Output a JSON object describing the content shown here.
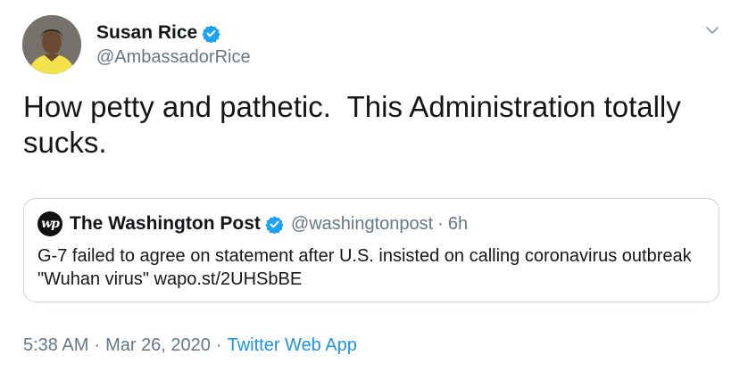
{
  "author": {
    "name": "Susan Rice",
    "handle": "@AmbassadorRice",
    "verified": true
  },
  "tweet": {
    "text": "How petty and pathetic.  This Administration totally sucks."
  },
  "quote": {
    "name": "The Washington Post",
    "handle": "@washingtonpost",
    "separator": "·",
    "time": "6h",
    "text": "G-7 failed to agree on statement after U.S. insisted on calling coronavirus outbreak \"Wuhan virus\" wapo.st/2UHSbBE"
  },
  "meta": {
    "time": "5:38 AM",
    "date": "Mar 26, 2020",
    "source": "Twitter Web App",
    "separator": "·"
  },
  "colors": {
    "primary_text": "#14171a",
    "secondary_text": "#657786",
    "link": "#1b95e0",
    "verified_badge": "#1da1f2",
    "border": "#ccd6dd"
  },
  "icons": {
    "verified": "verified-badge-icon",
    "menu": "chevron-down-icon",
    "quote_logo": "washington-post-logo-icon"
  }
}
